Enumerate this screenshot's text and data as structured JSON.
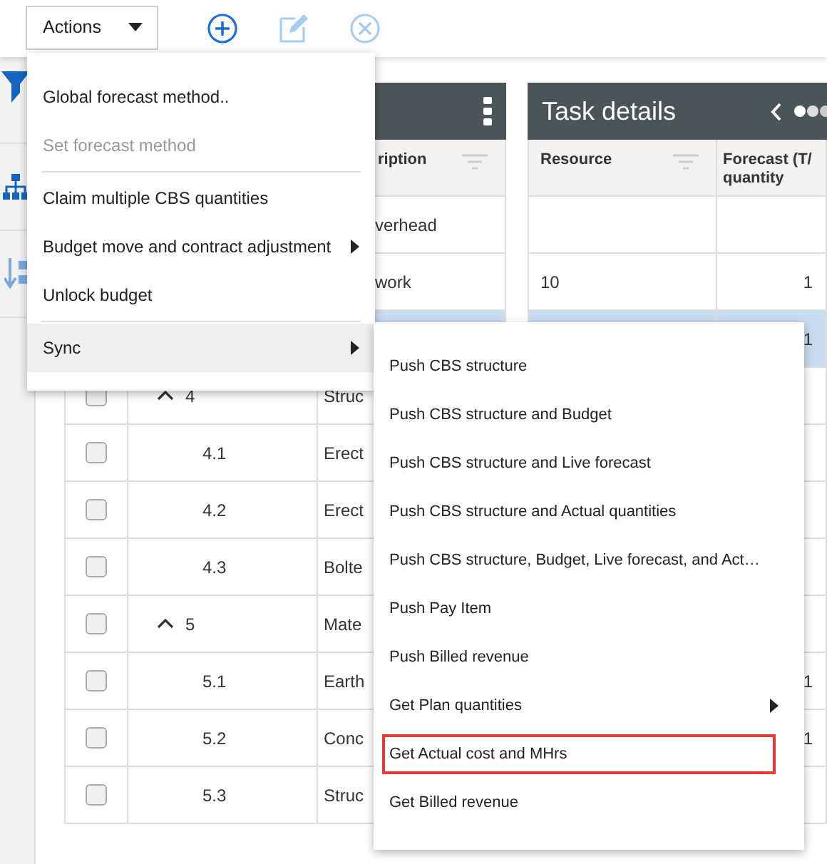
{
  "toolbar": {
    "actions": {
      "label": "Actions",
      "expanded": true
    },
    "buttons": [
      {
        "kind": "add",
        "disabled": false
      },
      {
        "kind": "edit",
        "disabled": true
      },
      {
        "kind": "delete",
        "disabled": true
      }
    ]
  },
  "sidebar": {
    "tools": [
      {
        "kind": "filter"
      },
      {
        "kind": "hierarchy"
      },
      {
        "kind": "sort"
      }
    ]
  },
  "cbs_panel": {
    "columns": [
      {
        "label": "ription",
        "filter": true
      }
    ],
    "rows": [
      {
        "description": "verhead",
        "selected": false
      },
      {
        "description": "work",
        "selected": false
      },
      {
        "selected": true
      },
      {
        "number": "4",
        "checked": false,
        "expanded": true,
        "description": "Struc",
        "selected": false,
        "children": [
          {
            "number": "4.1",
            "checked": false,
            "description": "Erect",
            "selected": false
          },
          {
            "number": "4.2",
            "checked": false,
            "description": "Erect",
            "selected": false
          },
          {
            "number": "4.3",
            "checked": false,
            "description": "Bolte",
            "selected": false
          }
        ]
      },
      {
        "number": "5",
        "checked": false,
        "expanded": true,
        "description": "Mate",
        "selected": false,
        "children": [
          {
            "number": "5.1",
            "checked": false,
            "description": "Earth",
            "selected": false
          },
          {
            "number": "5.2",
            "checked": false,
            "description": "Conc",
            "selected": false
          },
          {
            "number": "5.3",
            "checked": false,
            "description": "Struc",
            "selected": false
          }
        ]
      }
    ]
  },
  "task_panel": {
    "title": "Task details",
    "columns": [
      {
        "lines": [
          "Resource"
        ],
        "filter": true
      },
      {
        "lines": [
          "Forecast (T/",
          "quantity"
        ]
      }
    ],
    "rows": [
      {
        "selected": false
      },
      {
        "resource": "10",
        "forecast": "1",
        "selected": false
      },
      {
        "forecast": "1",
        "selected": true
      },
      {
        "selected": false
      },
      {
        "selected": false
      },
      {
        "selected": false
      },
      {
        "selected": false
      },
      {
        "selected": false
      },
      {
        "forecast": "1",
        "selected": false
      },
      {
        "forecast": "1",
        "selected": false
      },
      {
        "selected": false
      }
    ]
  },
  "actions_menu": {
    "groups": [
      [
        {
          "label": "Global forecast method..",
          "disabled": false,
          "has_submenu": false,
          "selected": false
        },
        {
          "label": "Set forecast method",
          "disabled": true,
          "has_submenu": false,
          "selected": false
        }
      ],
      [
        {
          "label": "Claim multiple CBS quantities",
          "disabled": false,
          "has_submenu": false,
          "selected": false
        },
        {
          "label": "Budget move and contract adjustment",
          "disabled": false,
          "has_submenu": true,
          "selected": false
        },
        {
          "label": "Unlock budget",
          "disabled": false,
          "has_submenu": false,
          "selected": false
        }
      ],
      [
        {
          "label": "Sync",
          "disabled": false,
          "has_submenu": true,
          "selected": true
        }
      ]
    ]
  },
  "sync_submenu": {
    "items": [
      {
        "label": "Push CBS structure",
        "has_submenu": false,
        "highlighted": false
      },
      {
        "label": "Push CBS structure and Budget",
        "has_submenu": false,
        "highlighted": false
      },
      {
        "label": "Push CBS structure and Live forecast",
        "has_submenu": false,
        "highlighted": false
      },
      {
        "label": "Push CBS structure and Actual quantities",
        "has_submenu": false,
        "highlighted": false
      },
      {
        "label": "Push CBS structure, Budget, Live forecast, and Act…",
        "has_submenu": false,
        "highlighted": false
      },
      {
        "label": "Push Pay Item",
        "has_submenu": false,
        "highlighted": false
      },
      {
        "label": "Push Billed revenue",
        "has_submenu": false,
        "highlighted": false
      },
      {
        "label": "Get Plan quantities",
        "has_submenu": true,
        "highlighted": false
      },
      {
        "label": "Get Actual cost and MHrs",
        "has_submenu": false,
        "highlighted": true
      },
      {
        "label": "Get Billed revenue",
        "has_submenu": false,
        "highlighted": false
      }
    ]
  }
}
